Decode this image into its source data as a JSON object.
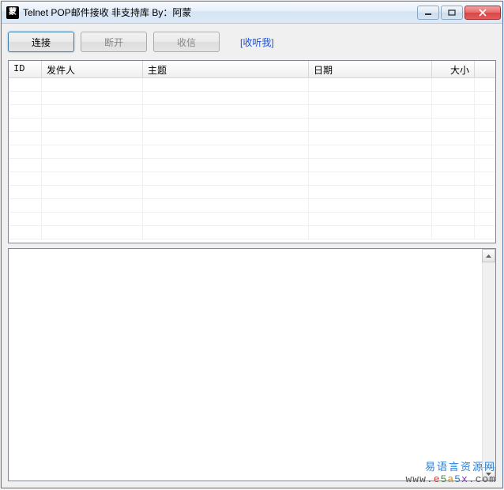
{
  "window": {
    "app_icon_text": "蒙",
    "title": "Telnet POP邮件接收 非支持库 By：阿蒙"
  },
  "toolbar": {
    "connect_label": "连接",
    "disconnect_label": "断开",
    "receive_label": "收信",
    "listen_label": "[收听我]"
  },
  "listview": {
    "columns": {
      "id": "ID",
      "sender": "发件人",
      "subject": "主题",
      "date": "日期",
      "size": "大小"
    },
    "rows": []
  },
  "textbox": {
    "content": ""
  },
  "watermark": {
    "line1": "易语言资源网",
    "line2_plain": "www.e5a5x.com"
  }
}
